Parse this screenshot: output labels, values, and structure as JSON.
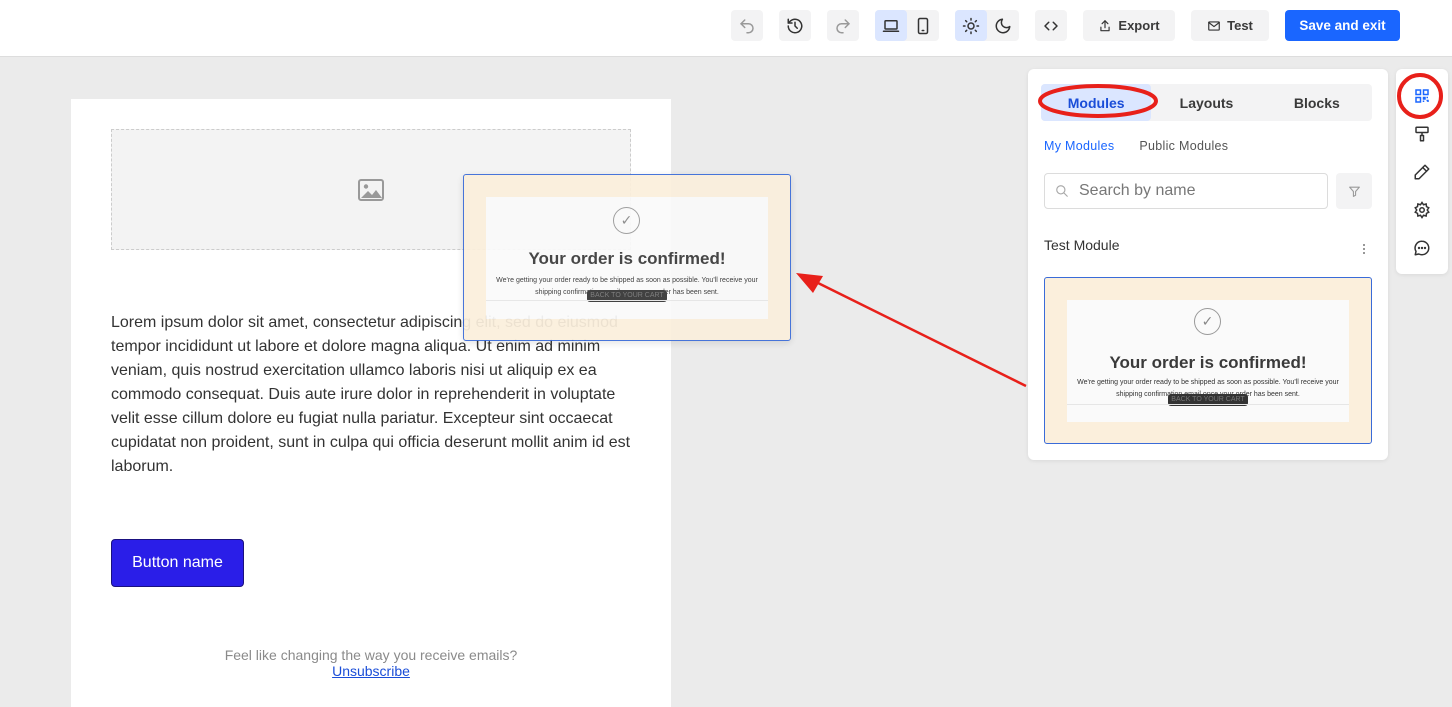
{
  "toolbar": {
    "export_label": "Export",
    "test_label": "Test",
    "save_label": "Save and exit",
    "icons": [
      "undo-icon",
      "history-icon",
      "redo-icon",
      "desktop-icon",
      "mobile-icon",
      "sun-icon",
      "moon-icon",
      "code-icon",
      "export-icon",
      "mail-icon"
    ]
  },
  "email": {
    "body_text": "Lorem ipsum dolor sit amet, consectetur adipiscing elit, sed do eiusmod tempor incididunt ut labore et dolore magna aliqua. Ut enim ad minim veniam, quis nostrud exercitation ullamco laboris nisi ut aliquip ex ea commodo consequat. Duis aute irure dolor in reprehenderit in voluptate velit esse cillum dolore eu fugiat nulla pariatur. Excepteur sint occaecat cupidatat non proident, sunt in culpa qui officia deserunt mollit anim id est laborum.",
    "button_label": "Button name",
    "footer_text": "Feel like changing the way you receive emails?",
    "unsubscribe_label": "Unsubscribe"
  },
  "module_preview": {
    "title": "Your order is confirmed!",
    "description": "We're getting your order ready to be shipped as soon as possible. You'll receive your shipping confirmation email once your order has been sent.",
    "cta": "BACK TO YOUR CART"
  },
  "panel": {
    "tabs": [
      "Modules",
      "Layouts",
      "Blocks"
    ],
    "active_tab": "Modules",
    "subtabs": [
      "My Modules",
      "Public Modules"
    ],
    "search_placeholder": "Search by name",
    "module_name": "Test Module"
  },
  "rail": {
    "icons": [
      "modules-icon",
      "paint-roller-icon",
      "pencil-icon",
      "settings-icon",
      "chat-icon"
    ]
  },
  "colors": {
    "primary": "#1a66ff",
    "email_button": "#2a1ee8",
    "annotation": "#e8201a",
    "module_background": "#fbefdc"
  }
}
